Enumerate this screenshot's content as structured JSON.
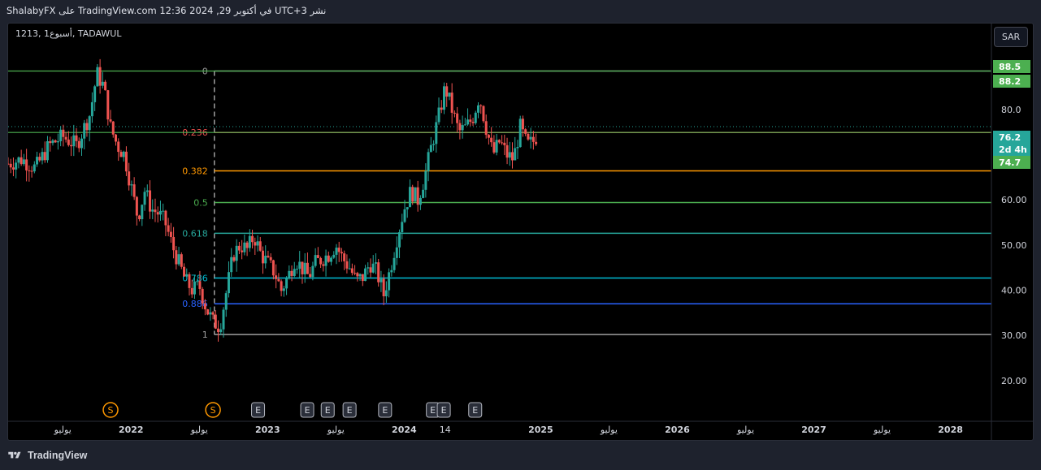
{
  "header": {
    "publish_text": "ShalabyFX على TradingView.com 12:36 2024 ,29 في أكتوبر UTC+3 نشر"
  },
  "symbol": {
    "text": "1213, أسبوع1, TADAWUL"
  },
  "currency_button": "SAR",
  "footer": {
    "brand": "TradingView"
  },
  "colors": {
    "up": "#26a69a",
    "down": "#ef5350",
    "price_badge": "#4caf50",
    "current_badge": "#26a69a"
  },
  "chart_data": {
    "type": "candlestick",
    "y_axis": {
      "min": 20,
      "max": 90,
      "ticks": [
        20.0,
        30.0,
        40.0,
        50.0,
        60.0,
        70.0,
        80.0
      ]
    },
    "y_tick_labels": [
      "20.00",
      "30.00",
      "40.00",
      "50.00",
      "60.00",
      "70.00",
      "80.0"
    ],
    "x_axis_labels": [
      "يوليو",
      "2022",
      "يوليو",
      "2023",
      "يوليو",
      "2024",
      "14",
      "2025",
      "يوليو",
      "2026",
      "يوليو",
      "2027",
      "يوليو",
      "2028"
    ],
    "x_axis_years": [
      2021.5,
      2022.0,
      2022.5,
      2023.0,
      2023.5,
      2024.0,
      2024.3,
      2025.0,
      2025.5,
      2026.0,
      2026.5,
      2027.0,
      2027.5,
      2028.0
    ],
    "fibonacci": [
      {
        "level": "0",
        "price": 88.5,
        "color": "#9e9e9e"
      },
      {
        "level": "0.236",
        "price": 74.9,
        "color": "#ef5350"
      },
      {
        "level": "0.382",
        "price": 66.4,
        "color": "#ff9800"
      },
      {
        "level": "0.5",
        "price": 59.4,
        "color": "#4caf50"
      },
      {
        "level": "0.618",
        "price": 52.6,
        "color": "#26a69a"
      },
      {
        "level": "0.786",
        "price": 42.7,
        "color": "#00bcd4"
      },
      {
        "level": "0.886",
        "price": 37.0,
        "color": "#2962ff"
      },
      {
        "level": "1",
        "price": 30.2,
        "color": "#9e9e9e"
      }
    ],
    "horizontal_lines": [
      {
        "price": 88.5,
        "color": "#4caf50"
      },
      {
        "price": 74.9,
        "color": "#4caf50"
      }
    ],
    "price_labels": [
      {
        "text": "88.5",
        "price": 88.5,
        "kind": "line"
      },
      {
        "text": "88.2",
        "price": 88.2,
        "kind": "line"
      },
      {
        "text": "76.2",
        "price": 76.2,
        "kind": "current"
      },
      {
        "text": "2d 4h",
        "price": 76.2,
        "kind": "countdown"
      },
      {
        "text": "74.7",
        "price": 74.7,
        "kind": "line"
      }
    ],
    "event_markers": [
      {
        "label": "S",
        "kind": "split",
        "t": 2021.85
      },
      {
        "label": "S",
        "kind": "split",
        "t": 2022.6
      },
      {
        "label": "E",
        "kind": "earnings",
        "t": 2022.93
      },
      {
        "label": "E",
        "kind": "earnings",
        "t": 2023.29
      },
      {
        "label": "E",
        "kind": "earnings",
        "t": 2023.44
      },
      {
        "label": "E",
        "kind": "earnings",
        "t": 2023.6
      },
      {
        "label": "E",
        "kind": "earnings",
        "t": 2023.86
      },
      {
        "label": "E",
        "kind": "earnings",
        "t": 2024.21
      },
      {
        "label": "E",
        "kind": "earnings",
        "t": 2024.29
      },
      {
        "label": "E",
        "kind": "earnings",
        "t": 2024.52
      }
    ],
    "price_path": [
      [
        2021.0,
        70
      ],
      [
        2021.1,
        68
      ],
      [
        2021.2,
        69
      ],
      [
        2021.3,
        67
      ],
      [
        2021.4,
        72
      ],
      [
        2021.5,
        74
      ],
      [
        2021.6,
        72
      ],
      [
        2021.7,
        79
      ],
      [
        2021.75,
        88
      ],
      [
        2021.8,
        85
      ],
      [
        2021.85,
        76
      ],
      [
        2021.9,
        72
      ],
      [
        2021.95,
        70
      ],
      [
        2022.0,
        63
      ],
      [
        2022.05,
        56
      ],
      [
        2022.1,
        62
      ],
      [
        2022.15,
        58
      ],
      [
        2022.2,
        57
      ],
      [
        2022.25,
        55
      ],
      [
        2022.3,
        50
      ],
      [
        2022.35,
        46
      ],
      [
        2022.4,
        42
      ],
      [
        2022.45,
        40
      ],
      [
        2022.5,
        41
      ],
      [
        2022.55,
        36
      ],
      [
        2022.6,
        33
      ],
      [
        2022.65,
        32
      ],
      [
        2022.7,
        40
      ],
      [
        2022.75,
        48
      ],
      [
        2022.8,
        50
      ],
      [
        2022.85,
        49
      ],
      [
        2022.9,
        52
      ],
      [
        2022.95,
        48
      ],
      [
        2023.0,
        46
      ],
      [
        2023.05,
        44
      ],
      [
        2023.1,
        40
      ],
      [
        2023.15,
        43
      ],
      [
        2023.2,
        47
      ],
      [
        2023.25,
        45
      ],
      [
        2023.3,
        43
      ],
      [
        2023.35,
        46
      ],
      [
        2023.4,
        47
      ],
      [
        2023.45,
        48
      ],
      [
        2023.5,
        50
      ],
      [
        2023.55,
        47
      ],
      [
        2023.6,
        45
      ],
      [
        2023.65,
        42
      ],
      [
        2023.7,
        43
      ],
      [
        2023.75,
        46
      ],
      [
        2023.8,
        44
      ],
      [
        2023.85,
        39
      ],
      [
        2023.9,
        45
      ],
      [
        2023.95,
        52
      ],
      [
        2024.0,
        58
      ],
      [
        2024.05,
        62
      ],
      [
        2024.1,
        60
      ],
      [
        2024.15,
        65
      ],
      [
        2024.2,
        72
      ],
      [
        2024.25,
        78
      ],
      [
        2024.3,
        85
      ],
      [
        2024.35,
        80
      ],
      [
        2024.4,
        75
      ],
      [
        2024.45,
        76
      ],
      [
        2024.5,
        78
      ],
      [
        2024.55,
        83
      ],
      [
        2024.6,
        76
      ],
      [
        2024.65,
        70
      ],
      [
        2024.7,
        73
      ],
      [
        2024.75,
        70
      ],
      [
        2024.8,
        69
      ],
      [
        2024.85,
        76
      ],
      [
        2024.9,
        72
      ],
      [
        2024.95,
        73
      ],
      [
        2025.0,
        76
      ]
    ]
  }
}
